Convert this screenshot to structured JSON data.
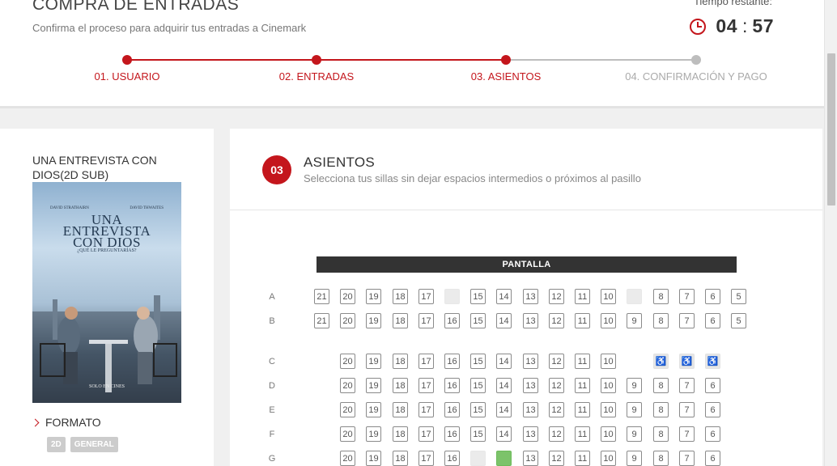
{
  "header": {
    "title": "COMPRA DE ENTRADAS",
    "subtitle": "Confirma el proceso para adquirir tus entradas a Cinemark",
    "timer_label": "Tiempo restante:",
    "timer_minutes": "04",
    "timer_sep": ":",
    "timer_seconds": "57"
  },
  "steps": [
    {
      "label": "01. USUARIO",
      "state": "done"
    },
    {
      "label": "02. ENTRADAS",
      "state": "done"
    },
    {
      "label": "03. ASIENTOS",
      "state": "active"
    },
    {
      "label": "04. CONFIRMACIÓN Y PAGO",
      "state": "pending"
    }
  ],
  "colors": {
    "accent": "#c4161c",
    "pending": "#bdbdbd",
    "selected_seat": "#7cc36a"
  },
  "movie": {
    "title": "UNA ENTREVISTA CON DIOS(2D SUB)",
    "poster": {
      "actor_left": "DAVID STRATHAIRN",
      "actor_right": "DAVID THWAITES",
      "title_line1": "UNA",
      "title_line2": "ENTREVISTA",
      "title_line3": "CON DIOS",
      "tagline": "¿QUÉ LE PREGUNTARÍAS?",
      "footer": "SOLO EN CINES"
    },
    "format_label": "FORMATO",
    "badges": [
      "2D",
      "GENERAL"
    ]
  },
  "section": {
    "number": "03",
    "title": "ASIENTOS",
    "subtitle": "Selecciona tus sillas sin dejar espacios intermedios o próximos al pasillo"
  },
  "screen_label": "PANTALLA",
  "seat_rows": [
    {
      "row": "A",
      "seats": [
        {
          "n": "21",
          "s": "a"
        },
        {
          "n": "20",
          "s": "a"
        },
        {
          "n": "19",
          "s": "a"
        },
        {
          "n": "18",
          "s": "a"
        },
        {
          "n": "17",
          "s": "a"
        },
        {
          "n": "",
          "s": "o"
        },
        {
          "n": "15",
          "s": "a"
        },
        {
          "n": "14",
          "s": "a"
        },
        {
          "n": "13",
          "s": "a"
        },
        {
          "n": "12",
          "s": "a"
        },
        {
          "n": "11",
          "s": "a"
        },
        {
          "n": "10",
          "s": "a"
        },
        {
          "n": "",
          "s": "o"
        },
        {
          "n": "8",
          "s": "a"
        },
        {
          "n": "7",
          "s": "a"
        },
        {
          "n": "6",
          "s": "a"
        },
        {
          "n": "5",
          "s": "a"
        }
      ]
    },
    {
      "row": "B",
      "seats": [
        {
          "n": "21",
          "s": "a"
        },
        {
          "n": "20",
          "s": "a"
        },
        {
          "n": "19",
          "s": "a"
        },
        {
          "n": "18",
          "s": "a"
        },
        {
          "n": "17",
          "s": "a"
        },
        {
          "n": "16",
          "s": "a"
        },
        {
          "n": "15",
          "s": "a"
        },
        {
          "n": "14",
          "s": "a"
        },
        {
          "n": "13",
          "s": "a"
        },
        {
          "n": "12",
          "s": "a"
        },
        {
          "n": "11",
          "s": "a"
        },
        {
          "n": "10",
          "s": "a"
        },
        {
          "n": "9",
          "s": "a"
        },
        {
          "n": "8",
          "s": "a"
        },
        {
          "n": "7",
          "s": "a"
        },
        {
          "n": "6",
          "s": "a"
        },
        {
          "n": "5",
          "s": "a"
        }
      ]
    },
    {
      "row": "C",
      "seats": [
        null,
        {
          "n": "20",
          "s": "a"
        },
        {
          "n": "19",
          "s": "a"
        },
        {
          "n": "18",
          "s": "a"
        },
        {
          "n": "17",
          "s": "a"
        },
        {
          "n": "16",
          "s": "a"
        },
        {
          "n": "15",
          "s": "a"
        },
        {
          "n": "14",
          "s": "a"
        },
        {
          "n": "13",
          "s": "a"
        },
        {
          "n": "12",
          "s": "a"
        },
        {
          "n": "11",
          "s": "a"
        },
        {
          "n": "10",
          "s": "a"
        },
        null,
        {
          "n": "♿",
          "s": "w"
        },
        {
          "n": "♿",
          "s": "w"
        },
        {
          "n": "♿",
          "s": "w"
        },
        null
      ]
    },
    {
      "row": "D",
      "seats": [
        null,
        {
          "n": "20",
          "s": "a"
        },
        {
          "n": "19",
          "s": "a"
        },
        {
          "n": "18",
          "s": "a"
        },
        {
          "n": "17",
          "s": "a"
        },
        {
          "n": "16",
          "s": "a"
        },
        {
          "n": "15",
          "s": "a"
        },
        {
          "n": "14",
          "s": "a"
        },
        {
          "n": "13",
          "s": "a"
        },
        {
          "n": "12",
          "s": "a"
        },
        {
          "n": "11",
          "s": "a"
        },
        {
          "n": "10",
          "s": "a"
        },
        {
          "n": "9",
          "s": "a"
        },
        {
          "n": "8",
          "s": "a"
        },
        {
          "n": "7",
          "s": "a"
        },
        {
          "n": "6",
          "s": "a"
        },
        null
      ]
    },
    {
      "row": "E",
      "seats": [
        null,
        {
          "n": "20",
          "s": "a"
        },
        {
          "n": "19",
          "s": "a"
        },
        {
          "n": "18",
          "s": "a"
        },
        {
          "n": "17",
          "s": "a"
        },
        {
          "n": "16",
          "s": "a"
        },
        {
          "n": "15",
          "s": "a"
        },
        {
          "n": "14",
          "s": "a"
        },
        {
          "n": "13",
          "s": "a"
        },
        {
          "n": "12",
          "s": "a"
        },
        {
          "n": "11",
          "s": "a"
        },
        {
          "n": "10",
          "s": "a"
        },
        {
          "n": "9",
          "s": "a"
        },
        {
          "n": "8",
          "s": "a"
        },
        {
          "n": "7",
          "s": "a"
        },
        {
          "n": "6",
          "s": "a"
        },
        null
      ]
    },
    {
      "row": "F",
      "seats": [
        null,
        {
          "n": "20",
          "s": "a"
        },
        {
          "n": "19",
          "s": "a"
        },
        {
          "n": "18",
          "s": "a"
        },
        {
          "n": "17",
          "s": "a"
        },
        {
          "n": "16",
          "s": "a"
        },
        {
          "n": "15",
          "s": "a"
        },
        {
          "n": "14",
          "s": "a"
        },
        {
          "n": "13",
          "s": "a"
        },
        {
          "n": "12",
          "s": "a"
        },
        {
          "n": "11",
          "s": "a"
        },
        {
          "n": "10",
          "s": "a"
        },
        {
          "n": "9",
          "s": "a"
        },
        {
          "n": "8",
          "s": "a"
        },
        {
          "n": "7",
          "s": "a"
        },
        {
          "n": "6",
          "s": "a"
        },
        null
      ]
    },
    {
      "row": "G",
      "seats": [
        null,
        {
          "n": "20",
          "s": "a"
        },
        {
          "n": "19",
          "s": "a"
        },
        {
          "n": "18",
          "s": "a"
        },
        {
          "n": "17",
          "s": "a"
        },
        {
          "n": "16",
          "s": "a"
        },
        {
          "n": "",
          "s": "o"
        },
        {
          "n": "",
          "s": "s"
        },
        {
          "n": "13",
          "s": "a"
        },
        {
          "n": "12",
          "s": "a"
        },
        {
          "n": "11",
          "s": "a"
        },
        {
          "n": "10",
          "s": "a"
        },
        {
          "n": "9",
          "s": "a"
        },
        {
          "n": "8",
          "s": "a"
        },
        {
          "n": "7",
          "s": "a"
        },
        {
          "n": "6",
          "s": "a"
        },
        null
      ]
    }
  ]
}
